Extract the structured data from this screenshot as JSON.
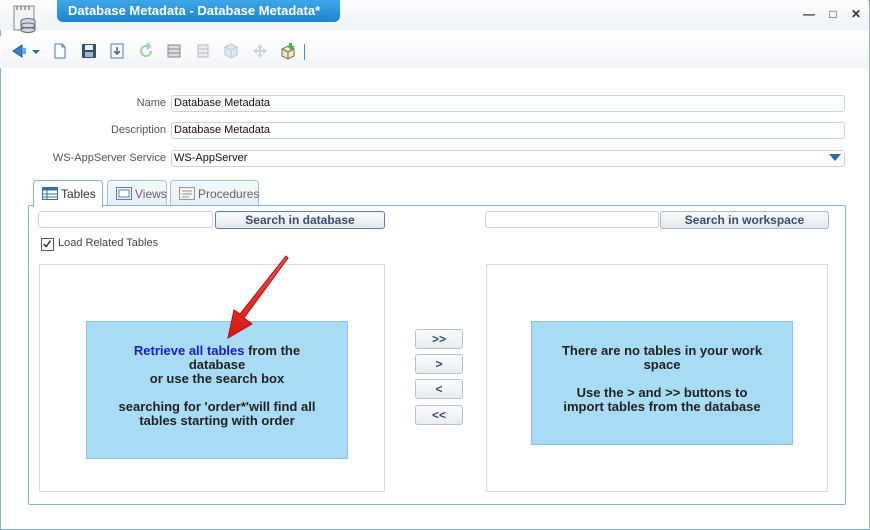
{
  "window": {
    "title": "Database Metadata - Database Metadata*",
    "minimize_glyph": "—",
    "maximize_glyph": "□",
    "close_glyph": "✕"
  },
  "toolbar": {
    "icons": [
      "back-icon",
      "dropdown-icon",
      "new-icon",
      "save-icon",
      "export-icon",
      "refresh-icon",
      "database-icon",
      "cabinet-icon",
      "cube-icon",
      "move-icon",
      "package-icon"
    ]
  },
  "form": {
    "name_label": "Name",
    "name_value": "Database Metadata",
    "description_label": "Description",
    "description_value": "Database Metadata",
    "service_label": "WS-AppServer Service",
    "service_value": "WS-AppServer"
  },
  "tabs": {
    "tables": "Tables",
    "views": "Views",
    "procedures": "Procedures"
  },
  "search": {
    "database_input_value": "",
    "database_button": "Search in database",
    "workspace_input_value": "",
    "workspace_button": "Search in workspace"
  },
  "load_related": {
    "label": "Load Related Tables",
    "checked": true
  },
  "left_info": {
    "link_text": "Retrieve all tables",
    "line1_rest": " from the",
    "line2": "database",
    "line3": "or use the search box",
    "line4": "searching for 'order*'will find all",
    "line5": "tables starting with order"
  },
  "move_buttons": {
    "add_all": ">>",
    "add": ">",
    "remove": "<",
    "remove_all": "<<"
  },
  "right_info": {
    "line1": "There are no tables in your work",
    "line2": "space",
    "line3": "Use the > and >> buttons to",
    "line4": "import tables from the database"
  },
  "colors": {
    "title_tab": "#1f8ad5",
    "info_box": "#a8dcf5",
    "link": "#1a1ad0",
    "annotation_arrow": "#e51e1e",
    "border": "#7fb4d8"
  }
}
